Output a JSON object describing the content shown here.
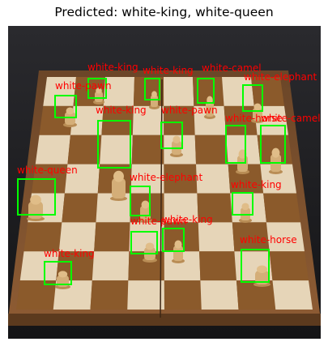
{
  "figure": {
    "title": "Predicted: white-king, white-queen"
  },
  "detections": [
    {
      "id": "d1",
      "label": "white-king"
    },
    {
      "id": "d2",
      "label": "white-king"
    },
    {
      "id": "d3",
      "label": "white-camel"
    },
    {
      "id": "d4",
      "label": "white-elephant"
    },
    {
      "id": "d5",
      "label": "white-pawn"
    },
    {
      "id": "d6",
      "label": "white-king"
    },
    {
      "id": "d7",
      "label": "white-pawn"
    },
    {
      "id": "d8",
      "label": "white-horse"
    },
    {
      "id": "d9",
      "label": "white-camel"
    },
    {
      "id": "d10",
      "label": "white-queen"
    },
    {
      "id": "d11",
      "label": "white-elephant"
    },
    {
      "id": "d12",
      "label": "white-king"
    },
    {
      "id": "d13",
      "label": "white-pawn"
    },
    {
      "id": "d14",
      "label": "white-king"
    },
    {
      "id": "d15",
      "label": "white-horse"
    },
    {
      "id": "d16",
      "label": "white-king"
    }
  ],
  "colors": {
    "box": "#00ff00",
    "label": "#ff0000",
    "wood": "#8a5a33",
    "light_square": "#e6d5b8",
    "dark_square": "#8b5a2b"
  }
}
